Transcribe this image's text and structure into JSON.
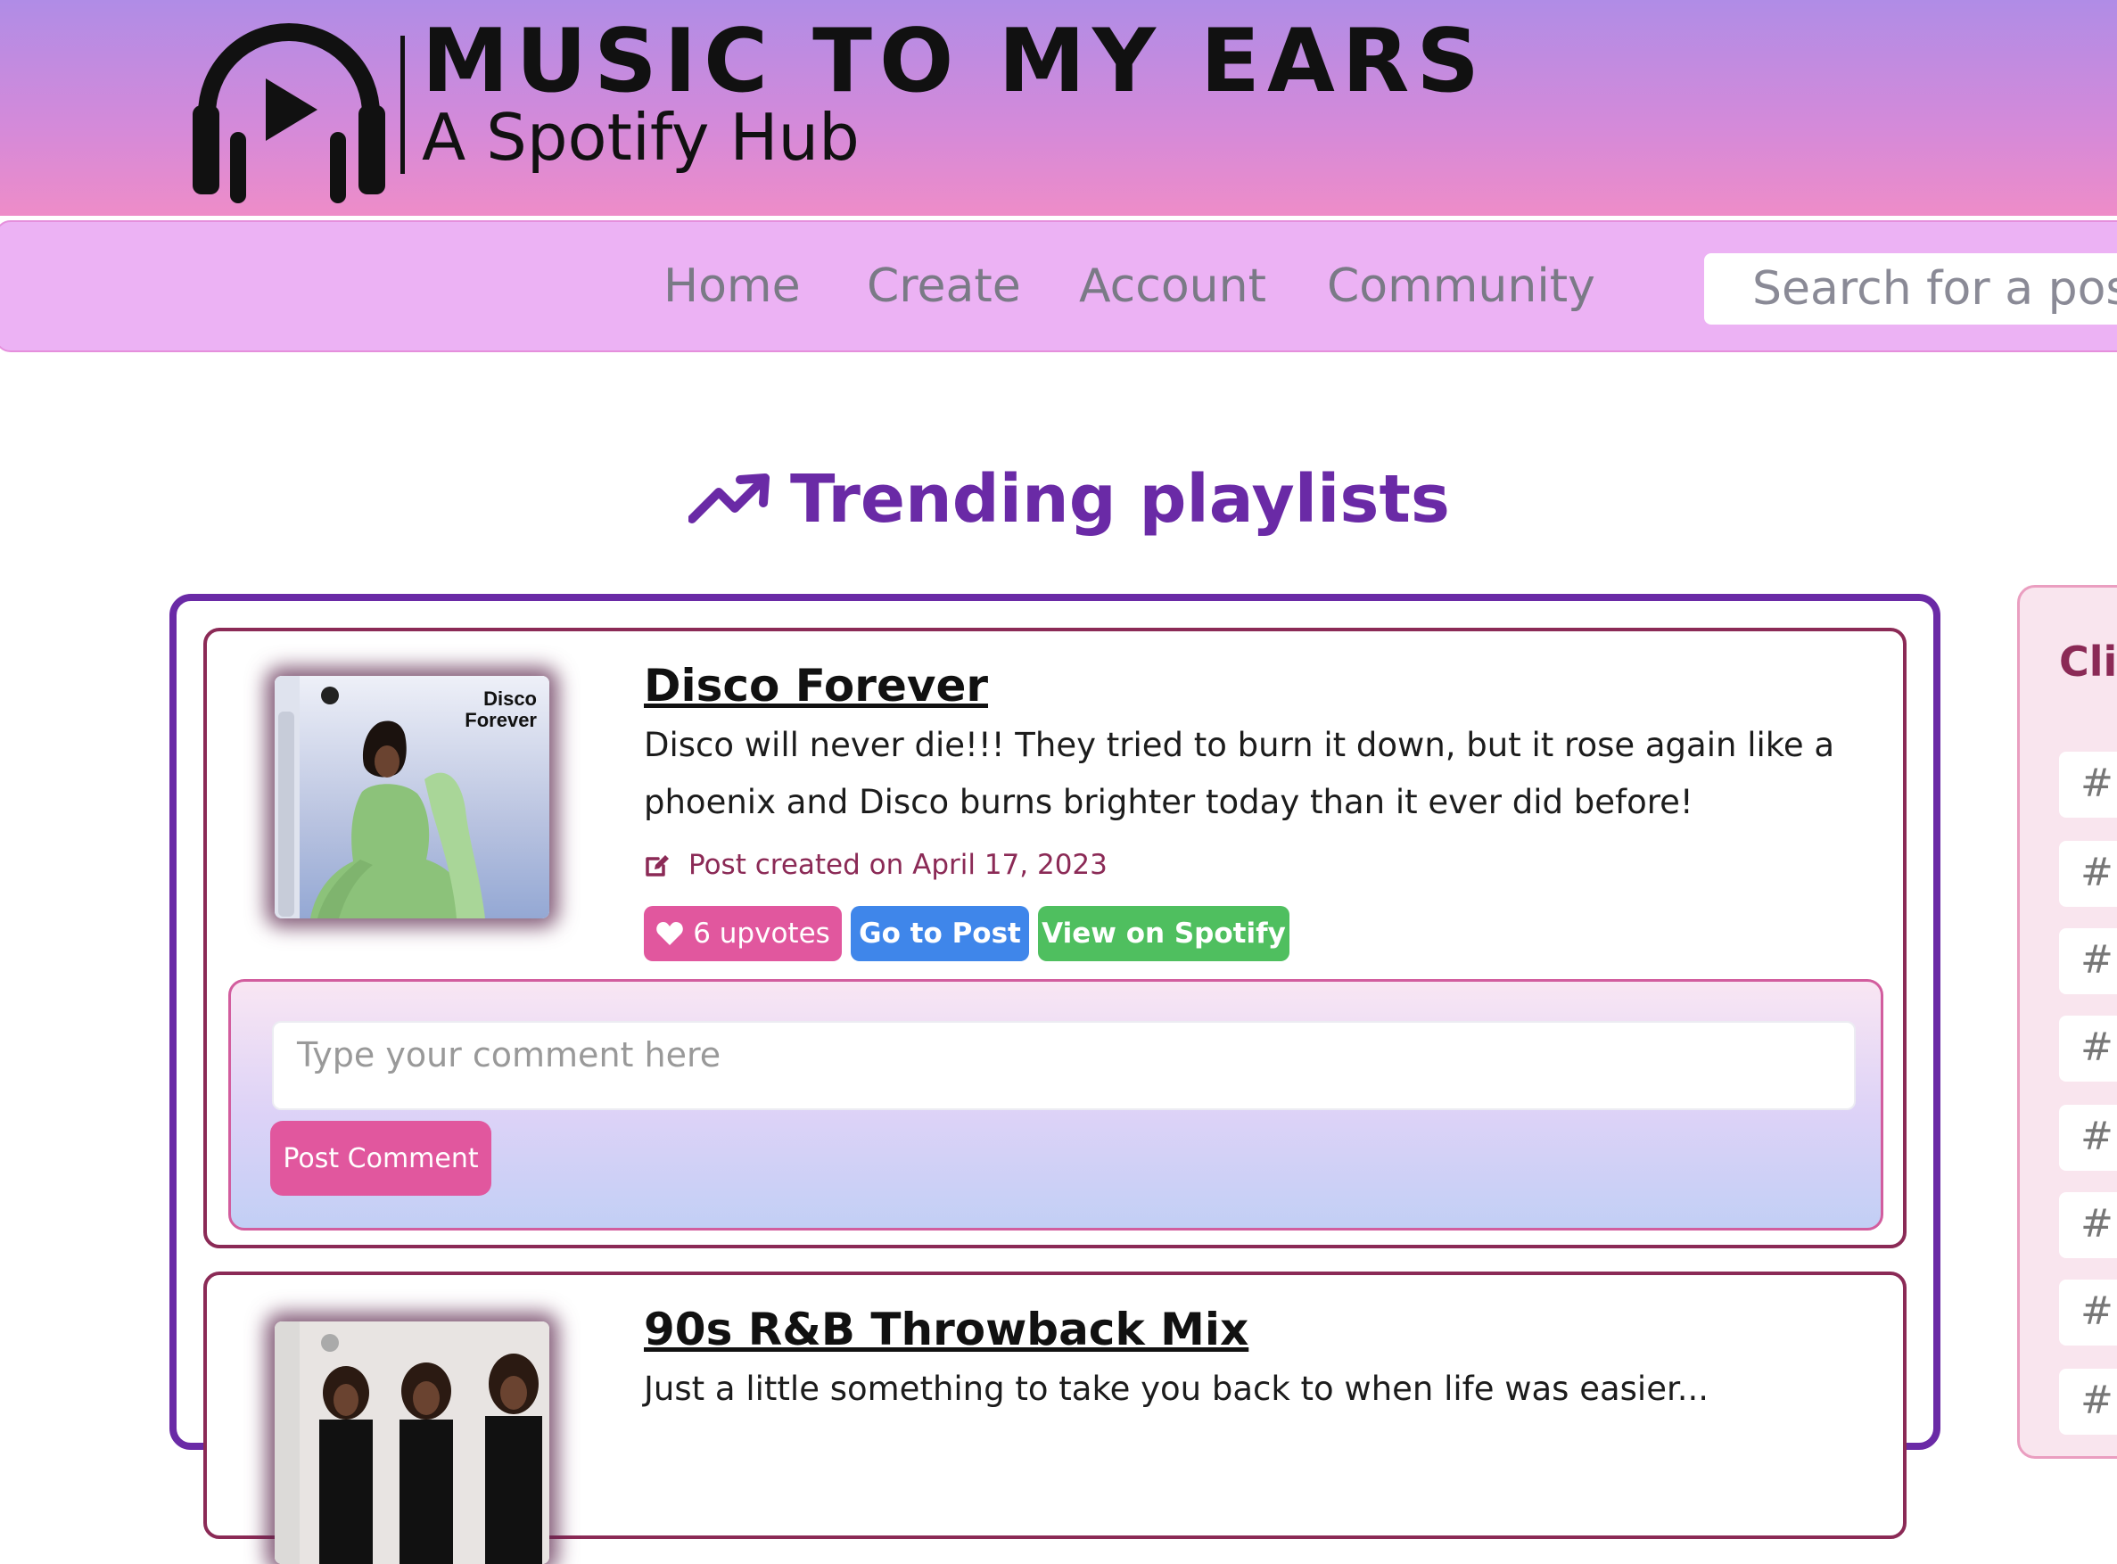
{
  "header": {
    "title": "MUSIC TO MY EARS",
    "subtitle": "A Spotify Hub"
  },
  "nav": {
    "items": [
      "Home",
      "Create",
      "Account",
      "Community"
    ],
    "search_placeholder": "Search for a post..."
  },
  "main": {
    "heading": "Trending playlists"
  },
  "posts": [
    {
      "title": "Disco Forever",
      "description": "Disco will never die!!! They tried to burn it down, but it rose again like a phoenix and Disco burns brighter today than it ever did before!",
      "date_text": "Post created on April 17, 2023",
      "cover_text": "Disco Forever",
      "upvotes_label": "6 upvotes",
      "go_label": "Go to Post",
      "spotify_label": "View on Spotify",
      "comment_placeholder": "Type your comment here",
      "comment_button": "Post Comment"
    },
    {
      "title": "90s R&B Throwback Mix",
      "description": "Just a little something to take you back to when life was easier..."
    }
  ],
  "sidebar": {
    "heading": "Clic",
    "tag_prefix": "#",
    "tags": [
      "#",
      "#",
      "#",
      "#",
      "#",
      "#",
      "#",
      "#"
    ]
  },
  "colors": {
    "accent": "#6a2aa6",
    "post_border": "#8b2a56",
    "upvote": "#e1579e",
    "go": "#3f86ea",
    "spotify": "#4fbf5f"
  }
}
